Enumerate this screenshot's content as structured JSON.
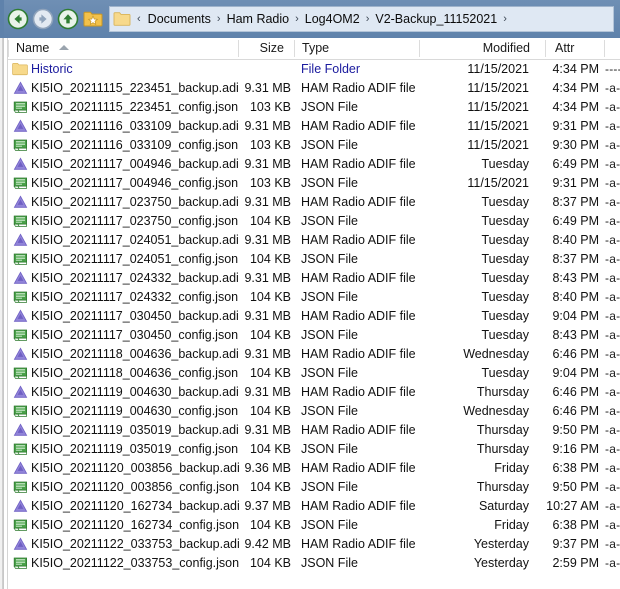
{
  "window": {
    "kind": "file-manager"
  },
  "toolbar": {
    "back_label": "Back",
    "forward_label": "Forward",
    "up_label": "Up one level",
    "favorites_label": "Favorites",
    "icons": {
      "back": "back-arrow-icon",
      "forward": "forward-arrow-icon",
      "up": "up-arrow-icon",
      "favorites": "favorites-star-folder-icon"
    }
  },
  "breadcrumb": {
    "folder_icon": "folder-icon",
    "lead_chevron": "‹",
    "separator": "›",
    "items": [
      "Documents",
      "Ham Radio",
      "Log4OM2",
      "V2-Backup_11152021"
    ],
    "trailing_separator": "›"
  },
  "columns": {
    "name": "Name",
    "size": "Size",
    "type": "Type",
    "modified": "Modified",
    "attr": "Attr",
    "sorted_by": "Name",
    "sort_direction": "ascending"
  },
  "colors": {
    "addressbar": "#5f82ab",
    "breadcrumb_field": "#dfe8f3",
    "folder_text": "#1a1a9e",
    "file_text": "#111111",
    "adif_icon": "#8f7fd4",
    "json_icon": "#46a046",
    "folder_icon": "#f6d98a"
  },
  "rows": [
    {
      "icon": "folder-icon",
      "name": "Historic",
      "size": "",
      "type": "File Folder",
      "date": "11/15/2021",
      "time": "4:34 PM",
      "attr": "-------",
      "is_folder": true
    },
    {
      "icon": "adif-file-icon",
      "name": "KI5IO_20211115_223451_backup.adi",
      "size": "9.31 MB",
      "type": "HAM Radio ADIF file",
      "date": "11/15/2021",
      "time": "4:34 PM",
      "attr": "-a-----",
      "is_folder": false
    },
    {
      "icon": "json-file-icon",
      "name": "KI5IO_20211115_223451_config.json",
      "size": "103 KB",
      "type": "JSON File",
      "date": "11/15/2021",
      "time": "4:34 PM",
      "attr": "-a-----",
      "is_folder": false
    },
    {
      "icon": "adif-file-icon",
      "name": "KI5IO_20211116_033109_backup.adi",
      "size": "9.31 MB",
      "type": "HAM Radio ADIF file",
      "date": "11/15/2021",
      "time": "9:31 PM",
      "attr": "-a-----",
      "is_folder": false
    },
    {
      "icon": "json-file-icon",
      "name": "KI5IO_20211116_033109_config.json",
      "size": "103 KB",
      "type": "JSON File",
      "date": "11/15/2021",
      "time": "9:30 PM",
      "attr": "-a-----",
      "is_folder": false
    },
    {
      "icon": "adif-file-icon",
      "name": "KI5IO_20211117_004946_backup.adi",
      "size": "9.31 MB",
      "type": "HAM Radio ADIF file",
      "date": "Tuesday",
      "time": "6:49 PM",
      "attr": "-a-----",
      "is_folder": false
    },
    {
      "icon": "json-file-icon",
      "name": "KI5IO_20211117_004946_config.json",
      "size": "103 KB",
      "type": "JSON File",
      "date": "11/15/2021",
      "time": "9:31 PM",
      "attr": "-a-----",
      "is_folder": false
    },
    {
      "icon": "adif-file-icon",
      "name": "KI5IO_20211117_023750_backup.adi",
      "size": "9.31 MB",
      "type": "HAM Radio ADIF file",
      "date": "Tuesday",
      "time": "8:37 PM",
      "attr": "-a-----",
      "is_folder": false
    },
    {
      "icon": "json-file-icon",
      "name": "KI5IO_20211117_023750_config.json",
      "size": "104 KB",
      "type": "JSON File",
      "date": "Tuesday",
      "time": "6:49 PM",
      "attr": "-a-----",
      "is_folder": false
    },
    {
      "icon": "adif-file-icon",
      "name": "KI5IO_20211117_024051_backup.adi",
      "size": "9.31 MB",
      "type": "HAM Radio ADIF file",
      "date": "Tuesday",
      "time": "8:40 PM",
      "attr": "-a-----",
      "is_folder": false
    },
    {
      "icon": "json-file-icon",
      "name": "KI5IO_20211117_024051_config.json",
      "size": "104 KB",
      "type": "JSON File",
      "date": "Tuesday",
      "time": "8:37 PM",
      "attr": "-a-----",
      "is_folder": false
    },
    {
      "icon": "adif-file-icon",
      "name": "KI5IO_20211117_024332_backup.adi",
      "size": "9.31 MB",
      "type": "HAM Radio ADIF file",
      "date": "Tuesday",
      "time": "8:43 PM",
      "attr": "-a-----",
      "is_folder": false
    },
    {
      "icon": "json-file-icon",
      "name": "KI5IO_20211117_024332_config.json",
      "size": "104 KB",
      "type": "JSON File",
      "date": "Tuesday",
      "time": "8:40 PM",
      "attr": "-a-----",
      "is_folder": false
    },
    {
      "icon": "adif-file-icon",
      "name": "KI5IO_20211117_030450_backup.adi",
      "size": "9.31 MB",
      "type": "HAM Radio ADIF file",
      "date": "Tuesday",
      "time": "9:04 PM",
      "attr": "-a-----",
      "is_folder": false
    },
    {
      "icon": "json-file-icon",
      "name": "KI5IO_20211117_030450_config.json",
      "size": "104 KB",
      "type": "JSON File",
      "date": "Tuesday",
      "time": "8:43 PM",
      "attr": "-a-----",
      "is_folder": false
    },
    {
      "icon": "adif-file-icon",
      "name": "KI5IO_20211118_004636_backup.adi",
      "size": "9.31 MB",
      "type": "HAM Radio ADIF file",
      "date": "Wednesday",
      "time": "6:46 PM",
      "attr": "-a-----",
      "is_folder": false
    },
    {
      "icon": "json-file-icon",
      "name": "KI5IO_20211118_004636_config.json",
      "size": "104 KB",
      "type": "JSON File",
      "date": "Tuesday",
      "time": "9:04 PM",
      "attr": "-a-----",
      "is_folder": false
    },
    {
      "icon": "adif-file-icon",
      "name": "KI5IO_20211119_004630_backup.adi",
      "size": "9.31 MB",
      "type": "HAM Radio ADIF file",
      "date": "Thursday",
      "time": "6:46 PM",
      "attr": "-a-----",
      "is_folder": false
    },
    {
      "icon": "json-file-icon",
      "name": "KI5IO_20211119_004630_config.json",
      "size": "104 KB",
      "type": "JSON File",
      "date": "Wednesday",
      "time": "6:46 PM",
      "attr": "-a-----",
      "is_folder": false
    },
    {
      "icon": "adif-file-icon",
      "name": "KI5IO_20211119_035019_backup.adi",
      "size": "9.31 MB",
      "type": "HAM Radio ADIF file",
      "date": "Thursday",
      "time": "9:50 PM",
      "attr": "-a-----",
      "is_folder": false
    },
    {
      "icon": "json-file-icon",
      "name": "KI5IO_20211119_035019_config.json",
      "size": "104 KB",
      "type": "JSON File",
      "date": "Thursday",
      "time": "9:16 PM",
      "attr": "-a-----",
      "is_folder": false
    },
    {
      "icon": "adif-file-icon",
      "name": "KI5IO_20211120_003856_backup.adi",
      "size": "9.36 MB",
      "type": "HAM Radio ADIF file",
      "date": "Friday",
      "time": "6:38 PM",
      "attr": "-a-----",
      "is_folder": false
    },
    {
      "icon": "json-file-icon",
      "name": "KI5IO_20211120_003856_config.json",
      "size": "104 KB",
      "type": "JSON File",
      "date": "Thursday",
      "time": "9:50 PM",
      "attr": "-a-----",
      "is_folder": false
    },
    {
      "icon": "adif-file-icon",
      "name": "KI5IO_20211120_162734_backup.adi",
      "size": "9.37 MB",
      "type": "HAM Radio ADIF file",
      "date": "Saturday",
      "time": "10:27 AM",
      "attr": "-a-----",
      "is_folder": false
    },
    {
      "icon": "json-file-icon",
      "name": "KI5IO_20211120_162734_config.json",
      "size": "104 KB",
      "type": "JSON File",
      "date": "Friday",
      "time": "6:38 PM",
      "attr": "-a-----",
      "is_folder": false
    },
    {
      "icon": "adif-file-icon",
      "name": "KI5IO_20211122_033753_backup.adi",
      "size": "9.42 MB",
      "type": "HAM Radio ADIF file",
      "date": "Yesterday",
      "time": "9:37 PM",
      "attr": "-a-----",
      "is_folder": false
    },
    {
      "icon": "json-file-icon",
      "name": "KI5IO_20211122_033753_config.json",
      "size": "104 KB",
      "type": "JSON File",
      "date": "Yesterday",
      "time": "2:59 PM",
      "attr": "-a-----",
      "is_folder": false
    }
  ]
}
